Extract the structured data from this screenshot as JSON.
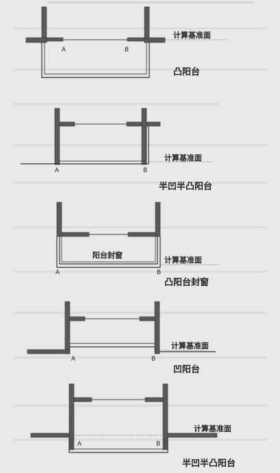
{
  "diagrams": [
    {
      "caption": "凸阳台",
      "calc_label": "计算基准面",
      "point_a": "A",
      "point_b": "B"
    },
    {
      "caption": "半凹半凸阳台",
      "calc_label": "计算基准面",
      "point_a": "A",
      "point_b": "B"
    },
    {
      "caption": "凸阳台封窗",
      "calc_label": "计算基准面",
      "point_a": "A",
      "point_b": "B",
      "inner_label": "阳台封窗"
    },
    {
      "caption": "凹阳台",
      "calc_label": "计算基准面",
      "point_a": "A",
      "point_b": "B"
    },
    {
      "caption": "半凹半凸阳台",
      "calc_label": "计算基准面",
      "point_a": "A",
      "point_b": "B"
    }
  ]
}
